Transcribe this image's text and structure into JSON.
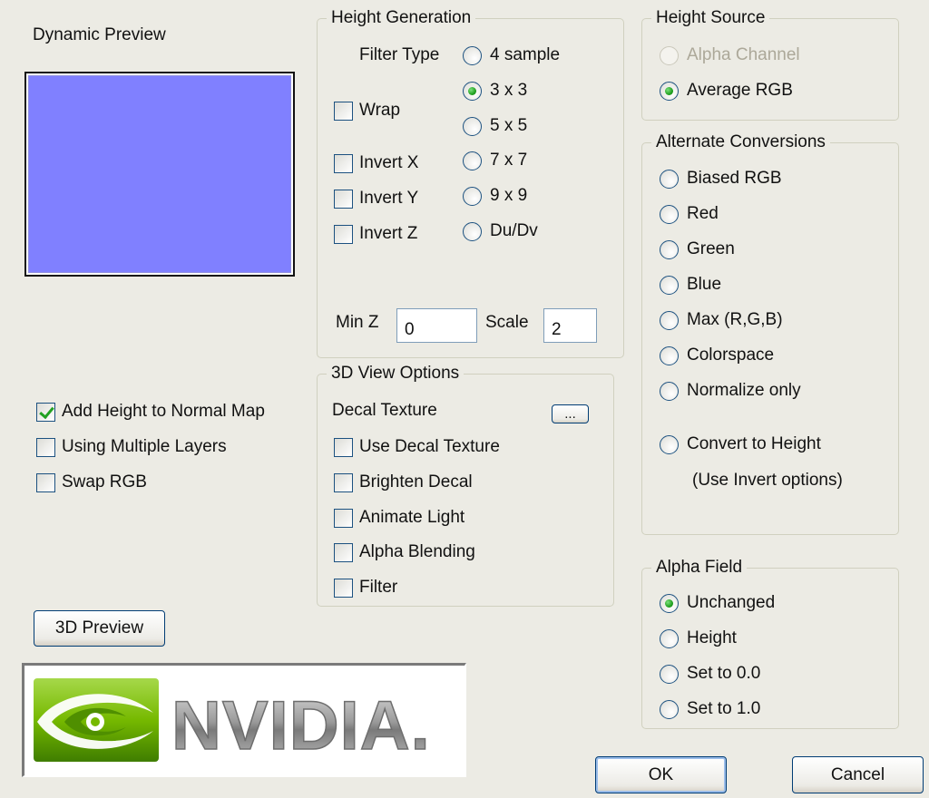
{
  "colors": {
    "preview_fill": "#8080ff",
    "dialog_bg": "#ecebe4",
    "radio_checked": "#21a121",
    "nvidia_green": "#76b900"
  },
  "dynamic_preview": {
    "title": "Dynamic Preview"
  },
  "height_generation": {
    "title": "Height Generation",
    "filter_type_label": "Filter Type",
    "filters": [
      {
        "label": "4 sample",
        "checked": false
      },
      {
        "label": "3 x 3",
        "checked": true
      },
      {
        "label": "5 x 5",
        "checked": false
      },
      {
        "label": "7 x 7",
        "checked": false
      },
      {
        "label": "9 x 9",
        "checked": false
      },
      {
        "label": "Du/Dv",
        "checked": false
      }
    ],
    "checkboxes": [
      {
        "label": "Wrap",
        "checked": false
      },
      {
        "label": "Invert X",
        "checked": false
      },
      {
        "label": "Invert Y",
        "checked": false
      },
      {
        "label": "Invert Z",
        "checked": false
      }
    ],
    "min_z_label": "Min Z",
    "min_z_value": "0",
    "scale_label": "Scale",
    "scale_value": "2"
  },
  "height_source": {
    "title": "Height Source",
    "options": [
      {
        "label": "Alpha Channel",
        "checked": false,
        "disabled": true
      },
      {
        "label": "Average RGB",
        "checked": true,
        "disabled": false
      }
    ]
  },
  "alternate_conversions": {
    "title": "Alternate Conversions",
    "options": [
      {
        "label": "Biased RGB",
        "checked": false
      },
      {
        "label": "Red",
        "checked": false
      },
      {
        "label": "Green",
        "checked": false
      },
      {
        "label": "Blue",
        "checked": false
      },
      {
        "label": "Max (R,G,B)",
        "checked": false
      },
      {
        "label": "Colorspace",
        "checked": false
      },
      {
        "label": "Normalize only",
        "checked": false
      },
      {
        "label": "Convert to Height",
        "checked": false
      }
    ],
    "note": "(Use Invert options)"
  },
  "left_options": [
    {
      "label": "Add Height to Normal Map",
      "checked": true
    },
    {
      "label": "Using Multiple Layers",
      "checked": false
    },
    {
      "label": "Swap RGB",
      "checked": false
    }
  ],
  "view_options": {
    "title": "3D View Options",
    "decal_texture_label": "Decal Texture",
    "browse_label": "...",
    "checkboxes": [
      {
        "label": "Use Decal Texture",
        "checked": false
      },
      {
        "label": "Brighten Decal",
        "checked": false
      },
      {
        "label": "Animate Light",
        "checked": false
      },
      {
        "label": "Alpha Blending",
        "checked": false
      },
      {
        "label": "Filter",
        "checked": false
      }
    ]
  },
  "alpha_field": {
    "title": "Alpha Field",
    "options": [
      {
        "label": "Unchanged",
        "checked": true
      },
      {
        "label": "Height",
        "checked": false
      },
      {
        "label": "Set to 0.0",
        "checked": false
      },
      {
        "label": "Set to 1.0",
        "checked": false
      }
    ]
  },
  "buttons": {
    "preview_3d": "3D Preview",
    "ok": "OK",
    "cancel": "Cancel"
  },
  "logo": {
    "text": "NVIDIA."
  }
}
